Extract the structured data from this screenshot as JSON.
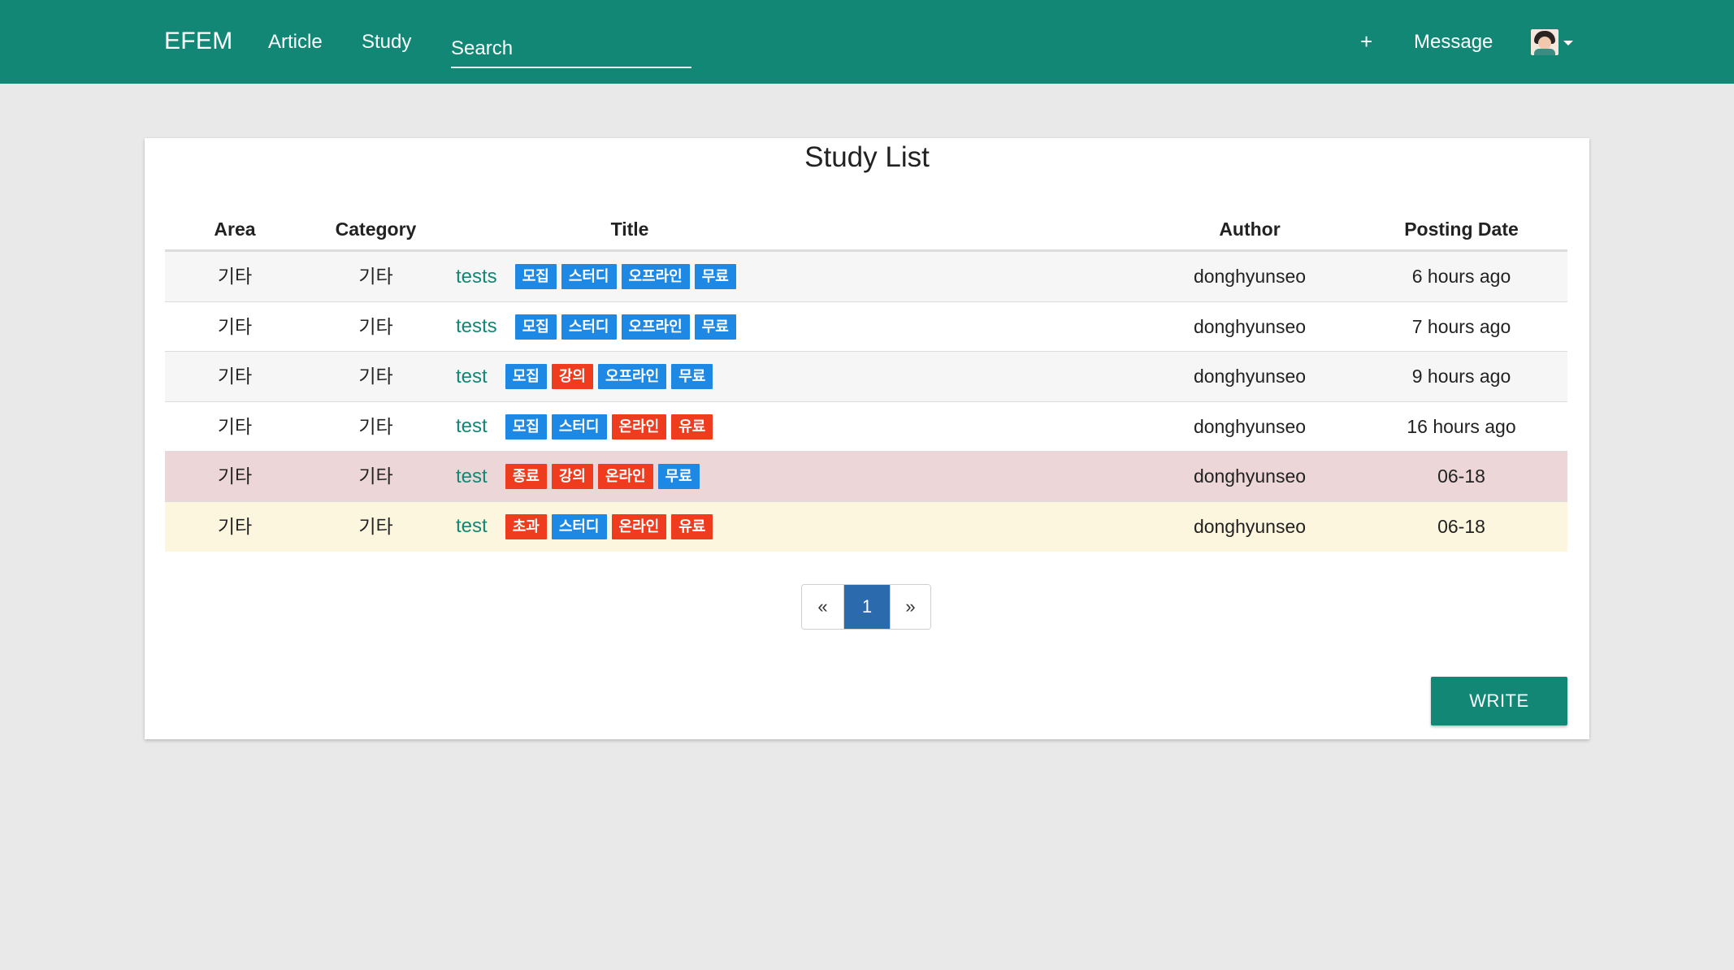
{
  "navbar": {
    "brand": "EFEM",
    "links": [
      "Article",
      "Study"
    ],
    "search_placeholder": "Search",
    "plus_label": "+",
    "message_label": "Message",
    "avatar_icon": "user-avatar",
    "bg_color": "#138776"
  },
  "main": {
    "title": "Study List",
    "columns": [
      "Area",
      "Category",
      "Title",
      "Author",
      "Posting Date"
    ],
    "rows": [
      {
        "area": "기타",
        "category": "기타",
        "title": "tests",
        "tags": [
          [
            "모집",
            "blue"
          ],
          [
            "스터디",
            "blue"
          ],
          [
            "오프라인",
            "blue"
          ],
          [
            "무료",
            "blue"
          ]
        ],
        "author": "donghyunseo",
        "date": "6 hours ago",
        "style": "even"
      },
      {
        "area": "기타",
        "category": "기타",
        "title": "tests",
        "tags": [
          [
            "모집",
            "blue"
          ],
          [
            "스터디",
            "blue"
          ],
          [
            "오프라인",
            "blue"
          ],
          [
            "무료",
            "blue"
          ]
        ],
        "author": "donghyunseo",
        "date": "7 hours ago",
        "style": "odd"
      },
      {
        "area": "기타",
        "category": "기타",
        "title": "test",
        "tags": [
          [
            "모집",
            "blue"
          ],
          [
            "강의",
            "red"
          ],
          [
            "오프라인",
            "blue"
          ],
          [
            "무료",
            "blue"
          ]
        ],
        "author": "donghyunseo",
        "date": "9 hours ago",
        "style": "even"
      },
      {
        "area": "기타",
        "category": "기타",
        "title": "test",
        "tags": [
          [
            "모집",
            "blue"
          ],
          [
            "스터디",
            "blue"
          ],
          [
            "온라인",
            "red"
          ],
          [
            "유료",
            "red"
          ]
        ],
        "author": "donghyunseo",
        "date": "16 hours ago",
        "style": "odd"
      },
      {
        "area": "기타",
        "category": "기타",
        "title": "test",
        "tags": [
          [
            "종료",
            "red"
          ],
          [
            "강의",
            "red"
          ],
          [
            "온라인",
            "red"
          ],
          [
            "무료",
            "blue"
          ]
        ],
        "author": "donghyunseo",
        "date": "06-18",
        "style": "danger"
      },
      {
        "area": "기타",
        "category": "기타",
        "title": "test",
        "tags": [
          [
            "초과",
            "red"
          ],
          [
            "스터디",
            "blue"
          ],
          [
            "온라인",
            "red"
          ],
          [
            "유료",
            "red"
          ]
        ],
        "author": "donghyunseo",
        "date": "06-18",
        "style": "warning"
      }
    ],
    "pagination": {
      "prev": "«",
      "current": "1",
      "next": "»"
    },
    "write_label": "WRITE"
  }
}
